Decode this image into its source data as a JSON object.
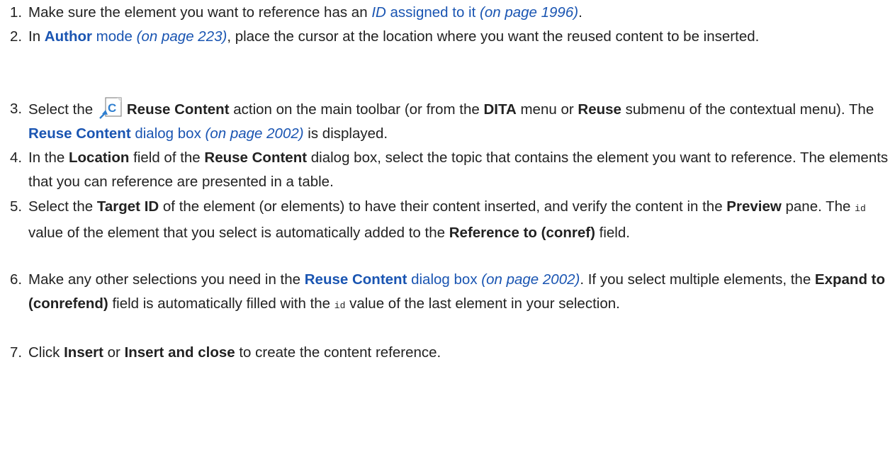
{
  "steps": [
    {
      "num": "1.",
      "t1": "Make sure the element you want to reference has an ",
      "id_link": "ID",
      "assigned_link": " assigned to it",
      "ref": " (on page 1996)",
      "t2": "."
    },
    {
      "num": "2.",
      "t1": "In ",
      "author": "Author",
      "mode_link": " mode",
      "ref": " (on page 223)",
      "t2": ", place the cursor at the location where you want the reused content to be inserted."
    },
    {
      "num": "3.",
      "t1": "Select the ",
      "icon_letter": "C",
      "action": "Reuse Content",
      "t2": " action on the main toolbar (or from the ",
      "dita": "DITA",
      "t3": " menu or ",
      "reuse": "Reuse",
      "t4": " submenu of the contextual menu). The ",
      "dialog_bold": "Reuse Content",
      "dialog_link": " dialog box",
      "ref": " (on page 2002)",
      "t5": " is displayed."
    },
    {
      "num": "4.",
      "t1": "In the ",
      "location": "Location",
      "t2": " field of the ",
      "reuse_content": "Reuse Content",
      "t3": " dialog box, select the topic that contains the element you want to reference. The elements that you can reference are presented in a table."
    },
    {
      "num": "5.",
      "t1": "Select the ",
      "target_id": "Target ID",
      "t2": " of the element (or elements) to have their content inserted, and verify the content in the ",
      "preview": "Preview",
      "t3": " pane. The ",
      "code_id": "id",
      "t4": " value of the element that you select is automatically added to the ",
      "reference_to": "Reference to (conref)",
      "t5": " field."
    },
    {
      "num": "6.",
      "t1": "Make any other selections you need in the ",
      "dialog_bold": "Reuse Content",
      "dialog_link": " dialog box",
      "ref": " (on page 2002)",
      "t2": ". If you select multiple elements, the ",
      "expand_to": "Expand to (conrefend)",
      "t3": " field is automatically filled with the ",
      "code_id": "id",
      "t4": " value of the last element in your selection."
    },
    {
      "num": "7.",
      "t1": "Click ",
      "insert": "Insert",
      "t2": " or ",
      "insert_close": "Insert and close",
      "t3": " to create the content reference."
    }
  ],
  "colors": {
    "text": "#222222",
    "link": "#1a55b2",
    "icon_accent": "#2f7fd0"
  },
  "icons": {
    "reuse_content": "reuse-content-icon"
  }
}
